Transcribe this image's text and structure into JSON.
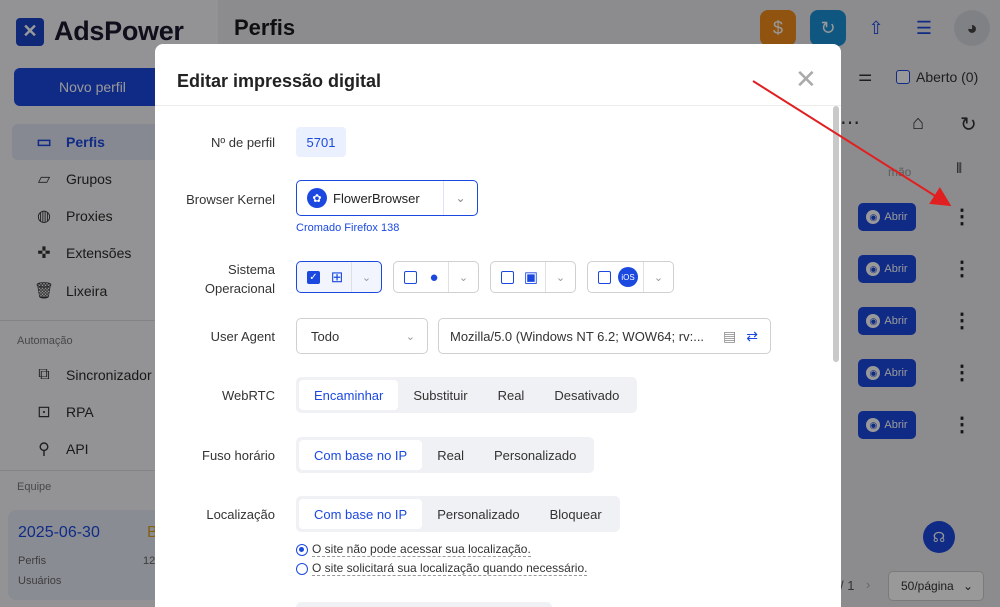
{
  "app": {
    "name": "AdsPower",
    "new_profile": "Novo perfil",
    "page_title": "Perfis"
  },
  "sidebar": {
    "items": [
      {
        "label": "Perfis",
        "icon": "profiles-icon"
      },
      {
        "label": "Grupos",
        "icon": "folder-icon"
      },
      {
        "label": "Proxies",
        "icon": "globe-icon"
      },
      {
        "label": "Extensões",
        "icon": "puzzle-icon"
      },
      {
        "label": "Lixeira",
        "icon": "trash-icon"
      }
    ],
    "automation_label": "Automação",
    "automation_items": [
      {
        "label": "Sincronizador",
        "icon": "sync-icon"
      },
      {
        "label": "RPA",
        "icon": "robot-icon"
      },
      {
        "label": "API",
        "icon": "api-icon"
      }
    ],
    "team_label": "Equipe",
    "card": {
      "date": "2025-06-30",
      "badge": "B",
      "profiles_label": "Perfis",
      "profiles_value": "12",
      "users_label": "Usuários"
    }
  },
  "toolbar": {
    "open_label": "Aberto (0)",
    "col_header": "mão"
  },
  "rows": [
    {
      "action": "Abrir"
    },
    {
      "action": "Abrir"
    },
    {
      "action": "Abrir"
    },
    {
      "action": "Abrir"
    },
    {
      "action": "Abrir"
    }
  ],
  "pager": {
    "pages": "/ 1",
    "page_size": "50/página"
  },
  "modal": {
    "title": "Editar impressão digital",
    "profile_no_label": "Nº de perfil",
    "profile_no": "5701",
    "kernel_label": "Browser Kernel",
    "kernel_value": "FlowerBrowser",
    "kernel_hint": "Cromado Firefox 138",
    "os_label_1": "Sistema",
    "os_label_2": "Operacional",
    "os_options": [
      {
        "name": "windows",
        "checked": true
      },
      {
        "name": "macos",
        "checked": false
      },
      {
        "name": "android",
        "checked": false
      },
      {
        "name": "ios",
        "checked": false,
        "badge": "iOS"
      }
    ],
    "ua_label": "User Agent",
    "ua_filter": "Todo",
    "ua_value": "Mozilla/5.0 (Windows NT 6.2; WOW64; rv:...",
    "webrtc_label": "WebRTC",
    "webrtc_options": [
      "Encaminhar",
      "Substituir",
      "Real",
      "Desativado"
    ],
    "webrtc_selected": "Encaminhar",
    "tz_label": "Fuso horário",
    "tz_options": [
      "Com base no IP",
      "Real",
      "Personalizado"
    ],
    "tz_selected": "Com base no IP",
    "loc_label": "Localização",
    "loc_options": [
      "Com base no IP",
      "Personalizado",
      "Bloquear"
    ],
    "loc_selected": "Com base no IP",
    "loc_radios": [
      {
        "text": "O site não pode acessar sua localização.",
        "checked": true
      },
      {
        "text": "O site solicitará sua localização quando necessário.",
        "checked": false
      }
    ]
  },
  "colors": {
    "accent": "#1b49e0",
    "annotation": "#e02020"
  }
}
